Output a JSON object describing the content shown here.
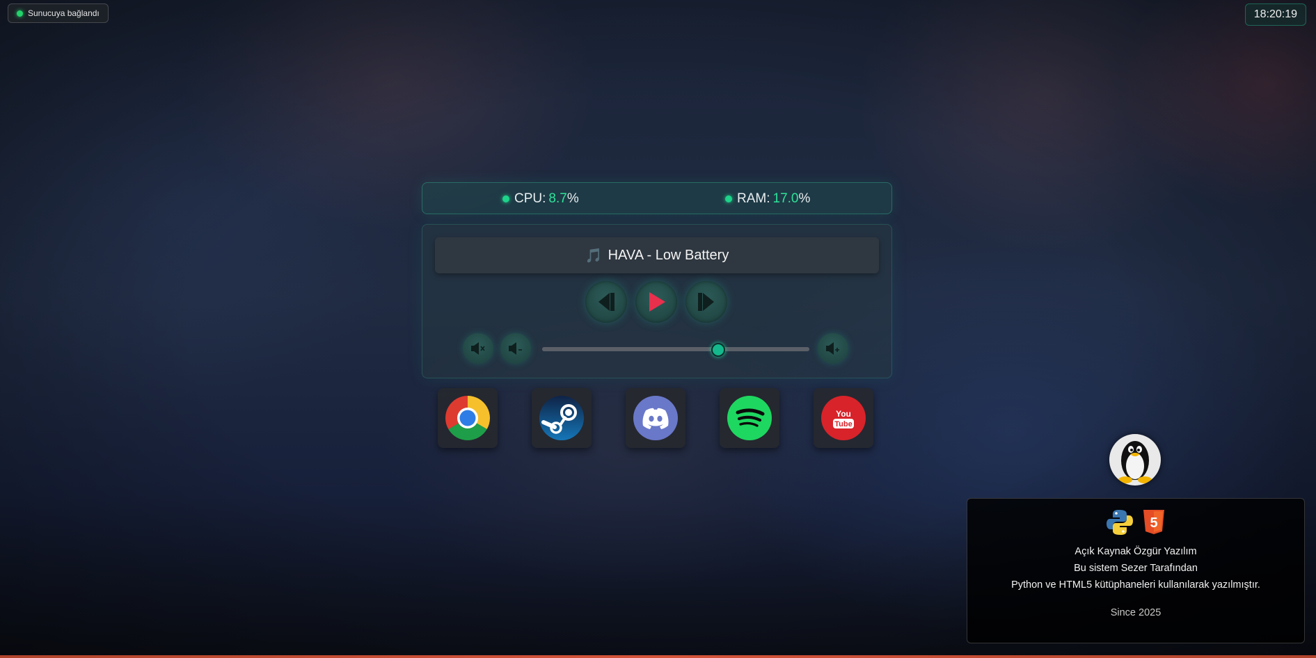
{
  "status": {
    "text": "Sunucuya bağlandı",
    "color": "#22d36b"
  },
  "clock": {
    "time": "18:20:19"
  },
  "stats": {
    "cpu_label": "CPU:",
    "cpu_value": "8.7",
    "cpu_unit": "%",
    "ram_label": "RAM:",
    "ram_value": "17.0",
    "ram_unit": "%"
  },
  "player": {
    "track_icon": "🎵",
    "track_title": "HAVA - Low Battery",
    "controls": [
      "previous-icon",
      "play-icon",
      "next-icon"
    ],
    "volume_buttons": [
      "volume-mute-icon",
      "volume-down-icon",
      "volume-up-icon"
    ],
    "volume_level": 0.66
  },
  "apps": [
    "chrome-icon",
    "steam-icon",
    "discord-icon",
    "spotify-icon",
    "youtube-icon"
  ],
  "about": {
    "logos": [
      "python-icon",
      "html5-icon"
    ],
    "line1": "Açık Kaynak Özgür Yazılım",
    "line2": "Bu sistem Sezer Tarafından",
    "line3": "Python ve HTML5 kütüphaneleri kullanılarak yazılmıştır.",
    "since": "Since 2025",
    "avatar": "tux-icon"
  },
  "colors": {
    "accent": "#2fe39a",
    "play": "#e8304d",
    "bottom_bar": "#d4543a"
  }
}
